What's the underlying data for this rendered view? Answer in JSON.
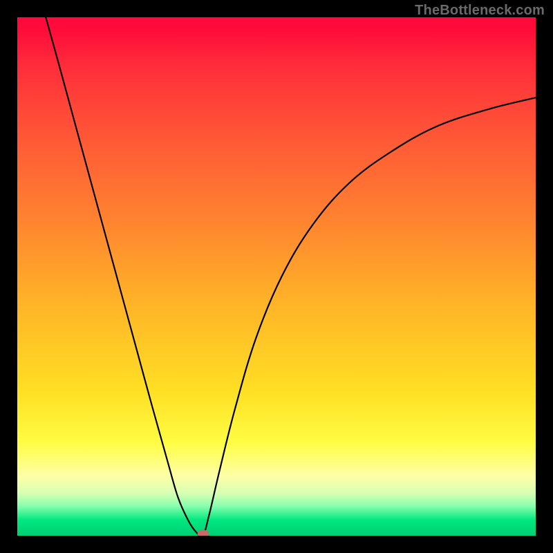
{
  "watermark": "TheBottleneck.com",
  "colors": {
    "frame_bg": "#000000",
    "curve_stroke": "#000000",
    "dot_fill": "#c76a6a",
    "watermark_text": "#6a6a6a"
  },
  "chart_data": {
    "type": "line",
    "title": "",
    "xlabel": "",
    "ylabel": "",
    "xlim": [
      0,
      1
    ],
    "ylim": [
      0,
      1
    ],
    "annotations": [],
    "series": [
      {
        "name": "left-branch",
        "x": [
          0.055,
          0.08,
          0.11,
          0.14,
          0.17,
          0.2,
          0.23,
          0.26,
          0.29,
          0.31,
          0.33,
          0.345,
          0.358
        ],
        "values": [
          1.0,
          0.91,
          0.8,
          0.69,
          0.58,
          0.47,
          0.36,
          0.25,
          0.143,
          0.074,
          0.029,
          0.007,
          0.0
        ]
      },
      {
        "name": "right-branch",
        "x": [
          0.358,
          0.37,
          0.39,
          0.42,
          0.46,
          0.51,
          0.57,
          0.64,
          0.72,
          0.81,
          0.91,
          1.0
        ],
        "values": [
          0.0,
          0.04,
          0.125,
          0.245,
          0.38,
          0.5,
          0.6,
          0.68,
          0.74,
          0.79,
          0.823,
          0.845
        ]
      }
    ],
    "marker": {
      "x": 0.358,
      "y": 0.0,
      "shape": "oval"
    },
    "background_gradient": {
      "direction": "top-to-bottom",
      "stops": [
        {
          "pos": 0.0,
          "color": "#ff0a3a"
        },
        {
          "pos": 0.38,
          "color": "#ff8030"
        },
        {
          "pos": 0.72,
          "color": "#ffdf24"
        },
        {
          "pos": 0.89,
          "color": "#fdffa7"
        },
        {
          "pos": 0.97,
          "color": "#00e87f"
        },
        {
          "pos": 1.0,
          "color": "#00d074"
        }
      ]
    }
  }
}
